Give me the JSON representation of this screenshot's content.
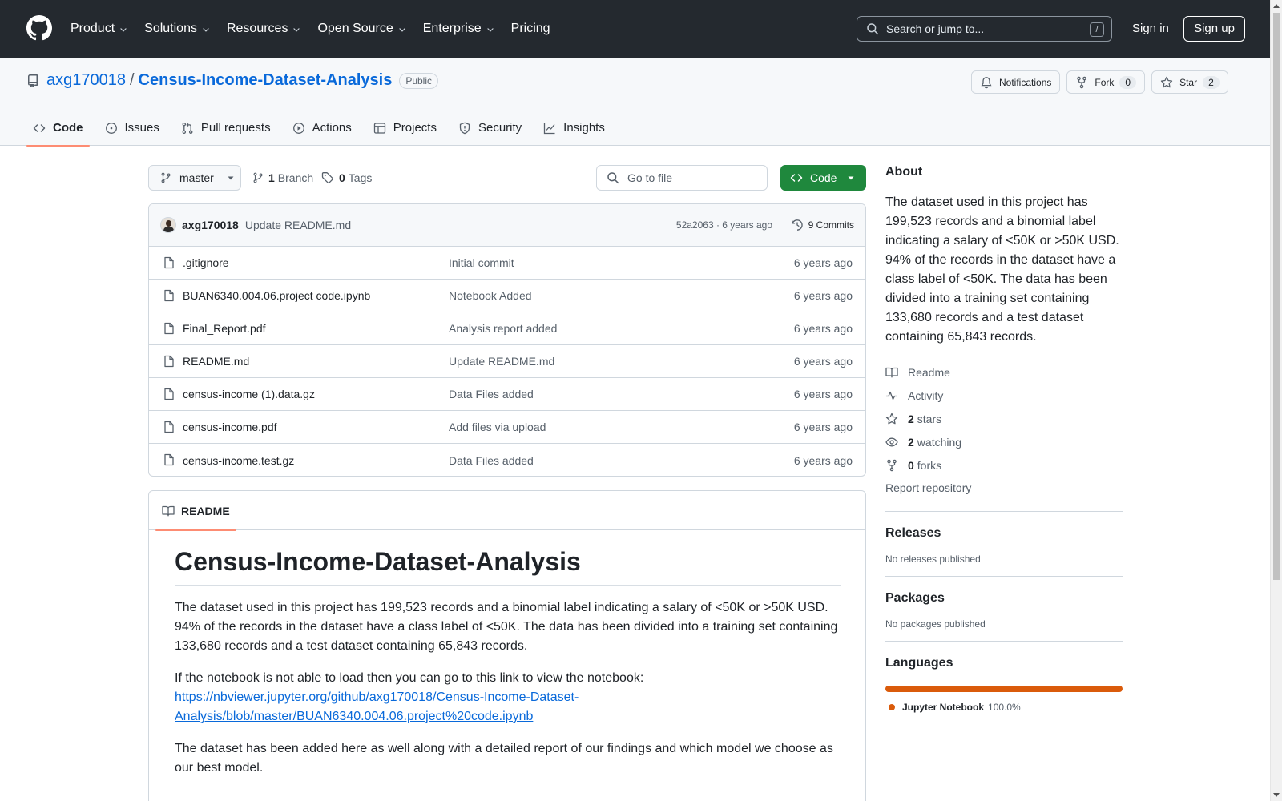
{
  "header": {
    "nav": [
      {
        "label": "Product",
        "has_menu": true
      },
      {
        "label": "Solutions",
        "has_menu": true
      },
      {
        "label": "Resources",
        "has_menu": true
      },
      {
        "label": "Open Source",
        "has_menu": true
      },
      {
        "label": "Enterprise",
        "has_menu": true
      },
      {
        "label": "Pricing",
        "has_menu": false
      }
    ],
    "search_placeholder": "Search or jump to...",
    "search_shortcut": "/",
    "signin_label": "Sign in",
    "signup_label": "Sign up"
  },
  "repo": {
    "owner": "axg170018",
    "separator": "/",
    "name": "Census-Income-Dataset-Analysis",
    "visibility": "Public",
    "notifications_label": "Notifications",
    "fork_label": "Fork",
    "fork_count": "0",
    "star_label": "Star",
    "star_count": "2",
    "tabs": [
      {
        "label": "Code",
        "icon": "code-icon",
        "active": true
      },
      {
        "label": "Issues",
        "icon": "issue-icon",
        "active": false
      },
      {
        "label": "Pull requests",
        "icon": "pull-request-icon",
        "active": false
      },
      {
        "label": "Actions",
        "icon": "play-icon",
        "active": false
      },
      {
        "label": "Projects",
        "icon": "table-icon",
        "active": false
      },
      {
        "label": "Security",
        "icon": "shield-icon",
        "active": false
      },
      {
        "label": "Insights",
        "icon": "graph-icon",
        "active": false
      }
    ]
  },
  "toolbar": {
    "branch": "master",
    "branch_count": "1",
    "branch_label": "Branch",
    "tag_count": "0",
    "tag_label": "Tags",
    "goto_placeholder": "Go to file",
    "code_label": "Code"
  },
  "latest_commit": {
    "author": "axg170018",
    "message": "Update README.md",
    "hash_and_time": "52a2063 · 6 years ago",
    "commits_label": "9 Commits"
  },
  "files": [
    {
      "name": ".gitignore",
      "commit": "Initial commit",
      "age": "6 years ago"
    },
    {
      "name": "BUAN6340.004.06.project code.ipynb",
      "commit": "Notebook Added",
      "age": "6 years ago"
    },
    {
      "name": "Final_Report.pdf",
      "commit": "Analysis report added",
      "age": "6 years ago"
    },
    {
      "name": "README.md",
      "commit": "Update README.md",
      "age": "6 years ago"
    },
    {
      "name": "census-income (1).data.gz",
      "commit": "Data Files added",
      "age": "6 years ago"
    },
    {
      "name": "census-income.pdf",
      "commit": "Add files via upload",
      "age": "6 years ago"
    },
    {
      "name": "census-income.test.gz",
      "commit": "Data Files added",
      "age": "6 years ago"
    }
  ],
  "readme": {
    "tab_label": "README",
    "title": "Census-Income-Dataset-Analysis",
    "p1": "The dataset used in this project has 199,523 records and a binomial label indicating a salary of <50K or >50K USD. 94% of the records in the dataset have a class label of <50K. The data has been divided into a training set containing 133,680 records and a test dataset containing 65,843 records.",
    "p2_text": "If the notebook is not able to load then you can go to this link to view the notebook:",
    "p2_link_line1": "https://nbviewer.jupyter.org/github/axg170018/Census-Income-Dataset-",
    "p2_link_line2": "Analysis/blob/master/BUAN6340.004.06.project%20code.ipynb",
    "p3": "The dataset has been added here as well along with a detailed report of our findings and which model we choose as our best model."
  },
  "about": {
    "heading": "About",
    "description": "The dataset used in this project has 199,523 records and a binomial label indicating a salary of <50K or >50K USD. 94% of the records in the dataset have a class label of <50K. The data has been divided into a training set containing 133,680 records and a test dataset containing 65,843 records.",
    "readme_label": "Readme",
    "activity_label": "Activity",
    "stars_count": "2",
    "stars_label": "stars",
    "watching_count": "2",
    "watching_label": "watching",
    "forks_count": "0",
    "forks_label": "forks",
    "report_label": "Report repository"
  },
  "releases": {
    "heading": "Releases",
    "note": "No releases published"
  },
  "packages": {
    "heading": "Packages",
    "note": "No packages published"
  },
  "languages": {
    "heading": "Languages",
    "items": [
      {
        "name": "Jupyter Notebook",
        "percent": "100.0%",
        "color": "#DA5B0B"
      }
    ]
  },
  "colors": {
    "header_bg": "#24292f",
    "link": "#0969da",
    "code_button": "#1f883d",
    "active_tab_underline": "#fd8c73"
  }
}
